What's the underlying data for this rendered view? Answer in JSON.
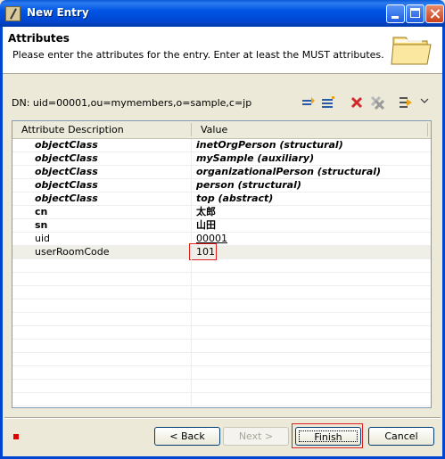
{
  "window": {
    "title": "New Entry"
  },
  "header": {
    "title": "Attributes",
    "description": "Please enter the attributes for the entry. Enter at least the MUST attributes."
  },
  "dn": {
    "label": "DN: uid=00001,ou=mymembers,o=sample,c=jp"
  },
  "toolbar": {
    "icons": [
      "new-attribute-icon",
      "new-value-icon",
      "delete-icon",
      "delete-all-icon",
      "show-quick-filter-icon",
      "view-menu-icon"
    ]
  },
  "table": {
    "columns": [
      "Attribute Description",
      "Value"
    ],
    "rows": [
      {
        "attr": "objectClass",
        "value": "inetOrgPerson (structural)"
      },
      {
        "attr": "objectClass",
        "value": "mySample (auxiliary)"
      },
      {
        "attr": "objectClass",
        "value": "organizationalPerson (structural)"
      },
      {
        "attr": "objectClass",
        "value": "person (structural)"
      },
      {
        "attr": "objectClass",
        "value": "top (abstract)"
      },
      {
        "attr": "cn",
        "value": "太郎"
      },
      {
        "attr": "sn",
        "value": "山田"
      },
      {
        "attr": "uid",
        "value": "00001"
      },
      {
        "attr": "userRoomCode",
        "value": "101"
      }
    ]
  },
  "buttons": {
    "back": "< Back",
    "next": "Next >",
    "finish": "Finish",
    "cancel": "Cancel"
  },
  "colors": {
    "title_bar": "#0055e5",
    "highlight_border": "#e0201e",
    "error_marker": "#e00000"
  }
}
